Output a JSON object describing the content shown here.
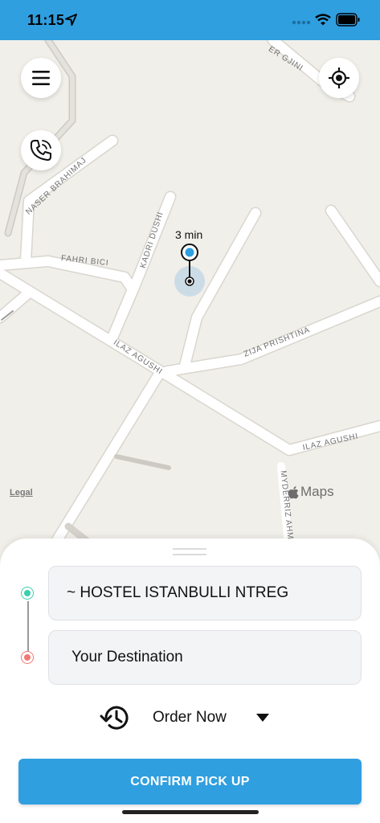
{
  "status_bar": {
    "time": "11:15",
    "icons": [
      "location-arrow-icon",
      "signal-dots-icon",
      "wifi-icon",
      "battery-icon"
    ],
    "background": "#2f9fe0"
  },
  "map": {
    "streets": {
      "naser_gjini": "ER GJINI",
      "naser_brahimaj": "NASER BRAHIMAJ",
      "kadri_dushi": "KADRI DUSHI",
      "fahri_bici": "FAHRI BICI",
      "ilaz_agushi": "ILAZ AGUSHI",
      "zija_prishtina": "ZIJA PRISHTINA",
      "ilaz_agushi_2": "ILAZ AGUSHI",
      "myderriz_ahme": "MYDERRIZ AHME"
    },
    "eta": "3 min",
    "legal": "Legal",
    "brand": "Maps",
    "buttons": [
      "menu-icon",
      "locate-icon",
      "phone-call-icon"
    ]
  },
  "sheet": {
    "origin": "~ HOSTEL ISTANBULLI NTREG",
    "destination": "Your Destination",
    "order_mode": "Order Now",
    "confirm": "CONFIRM PICK UP",
    "colors": {
      "origin": "#3ccfb0",
      "destination": "#f07a72",
      "accent": "#2f9fe0"
    }
  }
}
